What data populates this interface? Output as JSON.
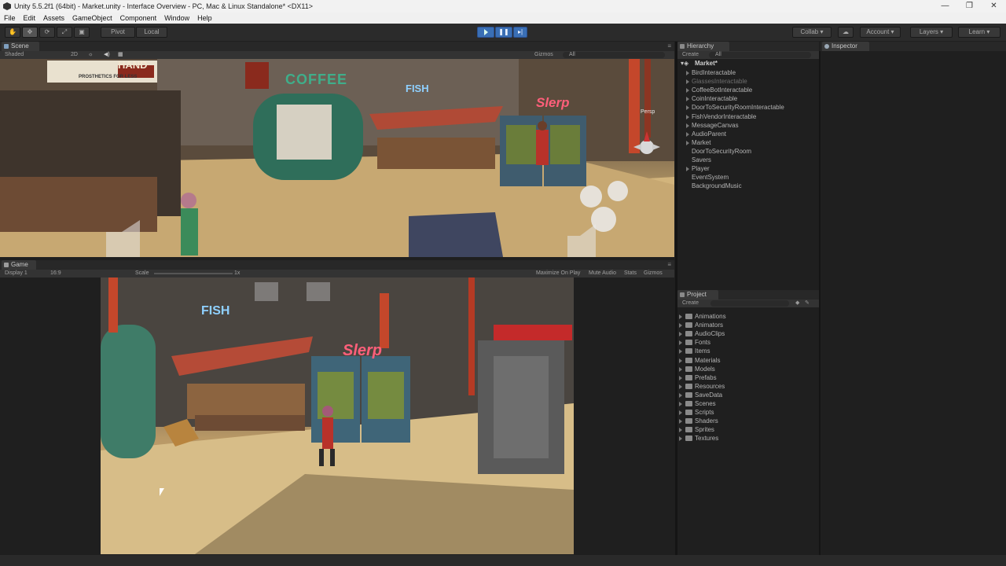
{
  "window": {
    "title": "Unity 5.5.2f1 (64bit) - Market.unity - Interface Overview - PC, Mac & Linux Standalone* <DX11>",
    "controls": [
      "—",
      "❐",
      "✕"
    ]
  },
  "menu": [
    "File",
    "Edit",
    "Assets",
    "GameObject",
    "Component",
    "Window",
    "Help"
  ],
  "toolbar": {
    "pivot": "Pivot",
    "local": "Local",
    "collab": "Collab",
    "account": "Account",
    "layers": "Layers",
    "learn": "Learn"
  },
  "scene": {
    "tab": "Scene",
    "shading": "Shaded",
    "mode2d": "2D",
    "gizmos": "Gizmos",
    "search": "All",
    "persp": "Persp",
    "signs": {
      "coffee": "COFFEE",
      "fish": "FISH",
      "slerp": "Slerp",
      "hand_top": "HAND",
      "hand_sub": "PROSTHETICS FOR LESS"
    }
  },
  "game": {
    "tab": "Game",
    "display": "Display 1",
    "aspect": "16:9",
    "scale_label": "Scale",
    "scale_value": "1x",
    "maximize": "Maximize On Play",
    "mute": "Mute Audio",
    "stats": "Stats",
    "gizmos": "Gizmos",
    "signs": {
      "fish": "FISH",
      "slerp": "Slerp"
    }
  },
  "hierarchy": {
    "tab": "Hierarchy",
    "create": "Create",
    "search": "All",
    "scene_name": "Market*",
    "items": [
      {
        "label": "BirdInteractable",
        "dim": false,
        "arrow": true
      },
      {
        "label": "GlassesInteractable",
        "dim": true,
        "arrow": true
      },
      {
        "label": "CoffeeBotInteractable",
        "dim": false,
        "arrow": true
      },
      {
        "label": "CoinInteractable",
        "dim": false,
        "arrow": true
      },
      {
        "label": "DoorToSecurityRoomInteractable",
        "dim": false,
        "arrow": true
      },
      {
        "label": "FishVendorInteractable",
        "dim": false,
        "arrow": true
      },
      {
        "label": "MessageCanvas",
        "dim": false,
        "arrow": true
      },
      {
        "label": "AudioParent",
        "dim": false,
        "arrow": true
      },
      {
        "label": "Market",
        "dim": false,
        "arrow": true
      },
      {
        "label": "DoorToSecurityRoom",
        "dim": false,
        "arrow": false
      },
      {
        "label": "Savers",
        "dim": false,
        "arrow": false
      },
      {
        "label": "Player",
        "dim": false,
        "arrow": true
      },
      {
        "label": "EventSystem",
        "dim": false,
        "arrow": false
      },
      {
        "label": "BackgroundMusic",
        "dim": false,
        "arrow": false
      }
    ]
  },
  "inspector": {
    "tab": "Inspector"
  },
  "project": {
    "tab": "Project",
    "create": "Create",
    "folders": [
      "Animations",
      "Animators",
      "AudioClips",
      "Fonts",
      "Items",
      "Materials",
      "Models",
      "Prefabs",
      "Resources",
      "SaveData",
      "Scenes",
      "Scripts",
      "Shaders",
      "Sprites",
      "Textures"
    ]
  },
  "colors": {
    "play_active": "#3a6fb5",
    "panel_bg": "#1f1f1f",
    "scene_accent_red": "#c0392b",
    "coffee_green": "#3fae8a",
    "fish_blue": "#8fd0ff"
  }
}
